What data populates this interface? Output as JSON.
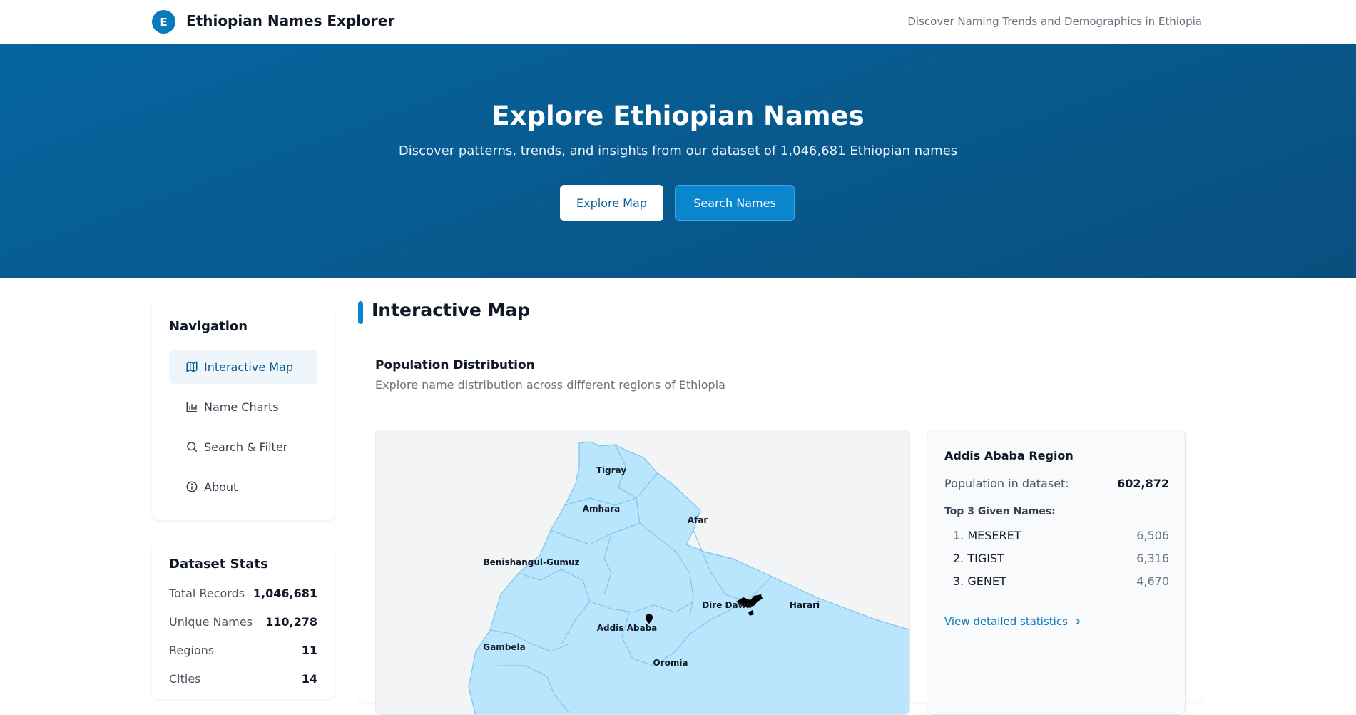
{
  "header": {
    "logo_letter": "E",
    "title": "Ethiopian Names Explorer",
    "tagline": "Discover Naming Trends and Demographics in Ethiopia"
  },
  "hero": {
    "title": "Explore Ethiopian Names",
    "subtitle": "Discover patterns, trends, and insights from our dataset of 1,046,681 Ethiopian names",
    "explore_button": "Explore Map",
    "search_button": "Search Names"
  },
  "sidebar": {
    "nav_title": "Navigation",
    "items": [
      {
        "label": "Interactive Map",
        "icon": "map-icon",
        "active": true
      },
      {
        "label": "Name Charts",
        "icon": "bar-chart-icon",
        "active": false
      },
      {
        "label": "Search & Filter",
        "icon": "search-icon",
        "active": false
      },
      {
        "label": "About",
        "icon": "info-icon",
        "active": false
      }
    ],
    "stats_title": "Dataset Stats",
    "stats": [
      {
        "label": "Total Records",
        "value": "1,046,681"
      },
      {
        "label": "Unique Names",
        "value": "110,278"
      },
      {
        "label": "Regions",
        "value": "11"
      },
      {
        "label": "Cities",
        "value": "14"
      }
    ]
  },
  "main": {
    "section_title": "Interactive Map",
    "card_title": "Population Distribution",
    "card_subtitle": "Explore name distribution across different regions of Ethiopia",
    "map_labels": [
      "Tigray",
      "Amhara",
      "Afar",
      "Benishangul-Gumuz",
      "Dire Dawa",
      "Harari",
      "Addis Ababa",
      "Gambela",
      "Oromia"
    ],
    "colors": {
      "region_fill": "#bae6fd",
      "region_stroke": "#7dc3e8",
      "accent": "#0a86cf"
    },
    "region_panel": {
      "title": "Addis Ababa Region",
      "population_label": "Population in dataset:",
      "population_value": "602,872",
      "top_names_label": "Top 3 Given Names:",
      "top_names": [
        {
          "name": "1. MESERET",
          "count": "6,506"
        },
        {
          "name": "2. TIGIST",
          "count": "6,316"
        },
        {
          "name": "3. GENET",
          "count": "4,670"
        }
      ],
      "link_label": "View detailed statistics"
    }
  }
}
